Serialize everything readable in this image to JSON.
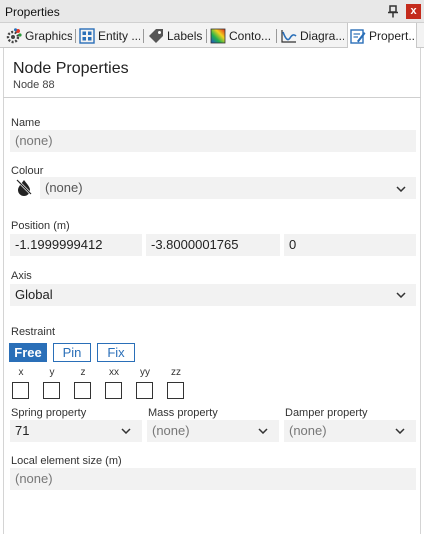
{
  "window": {
    "title": "Properties",
    "close_glyph": "x"
  },
  "tabs": [
    {
      "label": "Graphics",
      "icon": "gear-palette-icon"
    },
    {
      "label": "Entity ...",
      "icon": "grid-icon"
    },
    {
      "label": "Labels",
      "icon": "tag-icon"
    },
    {
      "label": "Conto...",
      "icon": "contour-icon"
    },
    {
      "label": "Diagra...",
      "icon": "diagram-icon"
    },
    {
      "label": "Propert...",
      "icon": "properties-icon",
      "active": true
    }
  ],
  "header": {
    "title": "Node Properties",
    "subtitle": "Node 88"
  },
  "name": {
    "label": "Name",
    "value": "(none)"
  },
  "colour": {
    "label": "Colour",
    "value": "(none)"
  },
  "position": {
    "label": "Position (m)",
    "x": "-1.1999999412",
    "y": "-3.8000001765",
    "z": "0"
  },
  "axis": {
    "label": "Axis",
    "value": "Global"
  },
  "restraint": {
    "label": "Restraint",
    "buttons": [
      "Free",
      "Pin",
      "Fix"
    ],
    "selected": "Free",
    "dofs": [
      "x",
      "y",
      "z",
      "xx",
      "yy",
      "zz"
    ]
  },
  "spring": {
    "label": "Spring property",
    "value": "71"
  },
  "mass": {
    "label": "Mass property",
    "value": "(none)"
  },
  "damper": {
    "label": "Damper property",
    "value": "(none)"
  },
  "local_size": {
    "label": "Local element size (m)",
    "value": "(none)"
  },
  "colors": {
    "accent": "#2a6fb8",
    "close": "#c42b1c",
    "field_bg": "#f2f2f2"
  }
}
